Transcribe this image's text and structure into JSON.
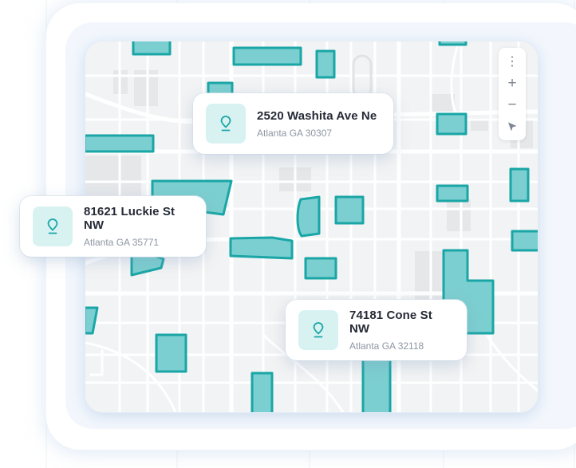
{
  "colors": {
    "accent": "#1aa6a6",
    "accent_fill": "#7ccfd0",
    "pin_tile": "#d8f2f2",
    "map_background": "#f2f3f4",
    "title_text": "#252a36",
    "subtitle_text": "#8d96a3"
  },
  "map": {
    "controls": [
      {
        "icon": "more-vertical-icon",
        "label": "⋮"
      },
      {
        "icon": "zoom-in-icon",
        "label": "+"
      },
      {
        "icon": "zoom-out-icon",
        "label": "−"
      },
      {
        "icon": "navigate-arrow-icon",
        "label": ""
      }
    ]
  },
  "locations": [
    {
      "title": "2520 Washita Ave Ne",
      "subtitle": "Atlanta GA 30307",
      "icon": "map-pin-icon"
    },
    {
      "title": "81621 Luckie St NW",
      "subtitle": "Atlanta GA 35771",
      "icon": "map-pin-icon"
    },
    {
      "title": "74181 Cone St NW",
      "subtitle": "Atlanta GA 32118",
      "icon": "map-pin-icon"
    }
  ]
}
